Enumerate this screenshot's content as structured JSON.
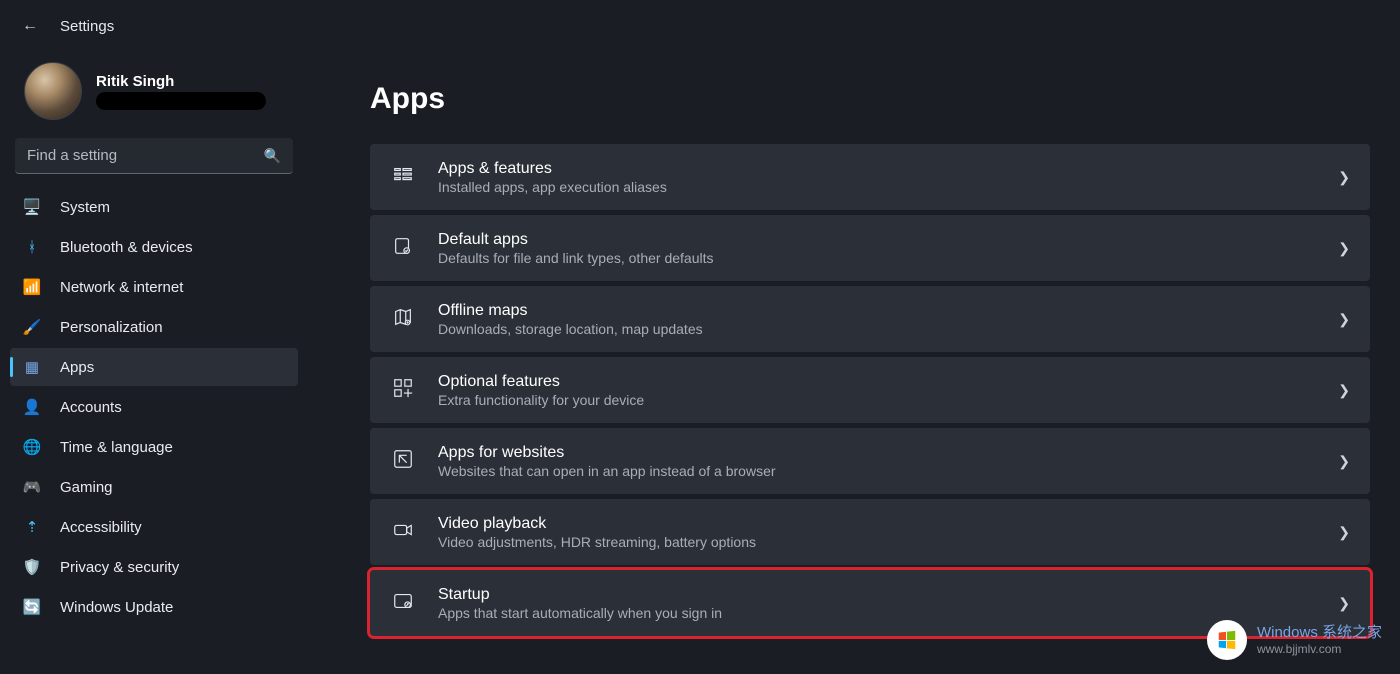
{
  "header": {
    "title": "Settings"
  },
  "user": {
    "name": "Ritik Singh"
  },
  "search": {
    "placeholder": "Find a setting"
  },
  "sidebar": {
    "items": [
      {
        "label": "System",
        "icon": "🖥️",
        "selected": false
      },
      {
        "label": "Bluetooth & devices",
        "icon": "ᚼ",
        "selected": false,
        "iconColor": "#4cc2ff"
      },
      {
        "label": "Network & internet",
        "icon": "📶",
        "selected": false,
        "iconColor": "#4cc2ff"
      },
      {
        "label": "Personalization",
        "icon": "🖌️",
        "selected": false
      },
      {
        "label": "Apps",
        "icon": "▦",
        "selected": true,
        "iconColor": "#7aa4e6"
      },
      {
        "label": "Accounts",
        "icon": "👤",
        "selected": false,
        "iconColor": "#5fc08c"
      },
      {
        "label": "Time & language",
        "icon": "🌐",
        "selected": false
      },
      {
        "label": "Gaming",
        "icon": "🎮",
        "selected": false,
        "iconColor": "#bfc3cc"
      },
      {
        "label": "Accessibility",
        "icon": "⇡",
        "selected": false,
        "iconColor": "#4cc2ff"
      },
      {
        "label": "Privacy & security",
        "icon": "🛡️",
        "selected": false,
        "iconColor": "#9aa0aa"
      },
      {
        "label": "Windows Update",
        "icon": "🔄",
        "selected": false,
        "iconColor": "#2fa8d8"
      }
    ]
  },
  "main": {
    "title": "Apps",
    "cards": [
      {
        "id": "apps-features",
        "title": "Apps & features",
        "sub": "Installed apps, app execution aliases",
        "highlight": false
      },
      {
        "id": "default-apps",
        "title": "Default apps",
        "sub": "Defaults for file and link types, other defaults",
        "highlight": false
      },
      {
        "id": "offline-maps",
        "title": "Offline maps",
        "sub": "Downloads, storage location, map updates",
        "highlight": false
      },
      {
        "id": "optional-features",
        "title": "Optional features",
        "sub": "Extra functionality for your device",
        "highlight": false
      },
      {
        "id": "apps-for-websites",
        "title": "Apps for websites",
        "sub": "Websites that can open in an app instead of a browser",
        "highlight": false
      },
      {
        "id": "video-playback",
        "title": "Video playback",
        "sub": "Video adjustments, HDR streaming, battery options",
        "highlight": false
      },
      {
        "id": "startup",
        "title": "Startup",
        "sub": "Apps that start automatically when you sign in",
        "highlight": true
      }
    ]
  },
  "watermark": {
    "line1": "Windows 系统之家",
    "line2": "www.bjjmlv.com"
  }
}
